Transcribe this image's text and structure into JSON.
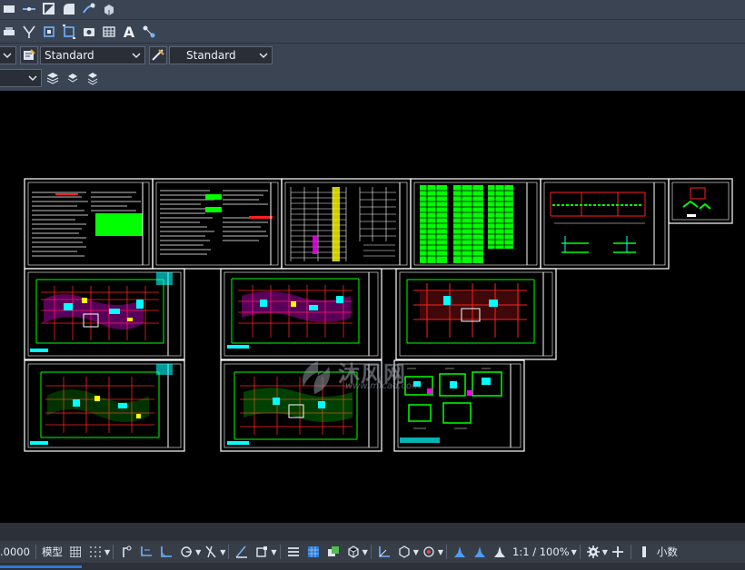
{
  "toolbars": {
    "row1_icons": [
      "rectangle-icon",
      "join-icon",
      "fillet-icon",
      "chamfer-icon",
      "blend-curves-icon",
      "3d-box-icon"
    ],
    "row2_icons": [
      "print-icon",
      "dimension-icon",
      "explode-icon",
      "scale-icon",
      "camera-icon",
      "table-icon",
      "text-icon",
      "multileader-icon"
    ],
    "text_style": {
      "value": "Standard"
    },
    "dim_style": {
      "value": "Standard"
    },
    "text_style_icon_label": "A"
  },
  "status_bar": {
    "coordinate": ".0000",
    "model_label": "模型",
    "annotation_scale": "1:1 / 100%",
    "units_label": "小数"
  },
  "watermark": {
    "brand_text": "沐风网",
    "url_text": "www.mfcad.com"
  },
  "colors": {
    "toolbar_bg": "#3b4453",
    "canvas_bg": "#000000",
    "status_bg": "#383e48",
    "accent_blue": "#2d7bd6",
    "cad_green": "#00ff00",
    "cad_red": "#ff0000",
    "cad_magenta": "#ff00ff",
    "cad_cyan": "#00ffff",
    "cad_yellow": "#ffff00"
  }
}
